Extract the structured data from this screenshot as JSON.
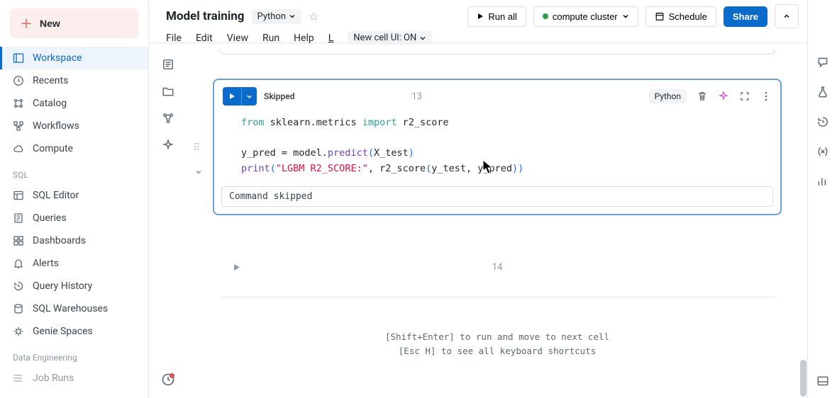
{
  "sidebar": {
    "new_label": "New",
    "items": [
      {
        "label": "Workspace"
      },
      {
        "label": "Recents"
      },
      {
        "label": "Catalog"
      },
      {
        "label": "Workflows"
      },
      {
        "label": "Compute"
      }
    ],
    "sql_label": "SQL",
    "sql_items": [
      {
        "label": "SQL Editor"
      },
      {
        "label": "Queries"
      },
      {
        "label": "Dashboards"
      },
      {
        "label": "Alerts"
      },
      {
        "label": "Query History"
      },
      {
        "label": "SQL Warehouses"
      },
      {
        "label": "Genie Spaces"
      }
    ],
    "de_label": "Data Engineering",
    "de_items": [
      {
        "label": "Job Runs"
      }
    ]
  },
  "header": {
    "title": "Model training",
    "language": "Python",
    "run_all": "Run all",
    "cluster": "compute cluster",
    "schedule": "Schedule",
    "share": "Share",
    "menu": [
      "File",
      "Edit",
      "View",
      "Run",
      "Help"
    ],
    "last_edit": "L",
    "new_cell_ui": "New cell UI: ON"
  },
  "cell": {
    "status": "Skipped",
    "number": "13",
    "lang_badge": "Python",
    "output": "Command skipped",
    "code_plain": "from sklearn.metrics import r2_score\n\ny_pred = model.predict(X_test)\nprint(\"LGBM R2_SCORE:\", r2_score(y_test, y_pred))"
  },
  "next_cell": {
    "number": "14"
  },
  "hints": {
    "line1": "[Shift+Enter] to run and move to next cell",
    "line2": "[Esc H] to see all keyboard shortcuts"
  }
}
